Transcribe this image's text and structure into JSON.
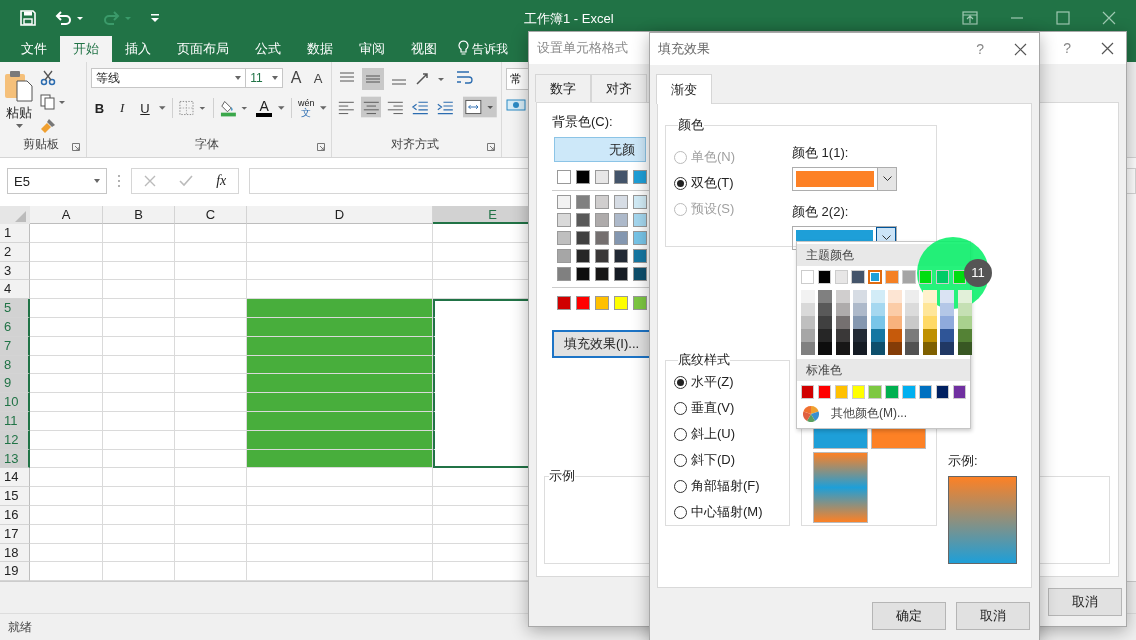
{
  "window": {
    "title": "工作簿1 - Excel"
  },
  "ribbon_tabs": [
    {
      "label": "文件",
      "kind": "tab",
      "selected": false
    },
    {
      "label": "开始",
      "kind": "tab",
      "selected": true
    },
    {
      "label": "插入",
      "kind": "tab",
      "selected": false
    },
    {
      "label": "页面布局",
      "kind": "tab",
      "selected": false
    },
    {
      "label": "公式",
      "kind": "tab",
      "selected": false
    },
    {
      "label": "数据",
      "kind": "tab",
      "selected": false
    },
    {
      "label": "审阅",
      "kind": "tab",
      "selected": false
    },
    {
      "label": "视图",
      "kind": "tab",
      "selected": false
    },
    {
      "label": "告诉我",
      "kind": "search",
      "selected": false
    }
  ],
  "clipboard": {
    "paste_label": "粘贴",
    "group_label": "剪贴板"
  },
  "font": {
    "name": "等线",
    "size": "11",
    "size_buttons": [
      "A",
      "A"
    ],
    "format_buttons": [
      "B",
      "I",
      "U"
    ],
    "color_letter": "A",
    "phonetic": "wén",
    "phonetic_char": "文",
    "group_label": "字体"
  },
  "alignment": {
    "group_label": "对齐方式"
  },
  "number": {
    "format": "常"
  },
  "name_box": "E5",
  "fx_label": "fx",
  "sheet": {
    "columns": [
      {
        "label": "A",
        "selected": false
      },
      {
        "label": "B",
        "selected": false
      },
      {
        "label": "C",
        "selected": false
      },
      {
        "label": "D",
        "selected": false,
        "color": "#48ae3c"
      },
      {
        "label": "E",
        "selected": true
      }
    ],
    "rows": [
      {
        "label": "1",
        "selected": false,
        "filled": false
      },
      {
        "label": "2",
        "selected": false,
        "filled": false
      },
      {
        "label": "3",
        "selected": false,
        "filled": false
      },
      {
        "label": "4",
        "selected": false,
        "filled": false
      },
      {
        "label": "5",
        "selected": true,
        "filled": true
      },
      {
        "label": "6",
        "selected": true,
        "filled": true
      },
      {
        "label": "7",
        "selected": true,
        "filled": true
      },
      {
        "label": "8",
        "selected": true,
        "filled": true
      },
      {
        "label": "9",
        "selected": true,
        "filled": true
      },
      {
        "label": "10",
        "selected": true,
        "filled": true
      },
      {
        "label": "11",
        "selected": true,
        "filled": true
      },
      {
        "label": "12",
        "selected": true,
        "filled": true
      },
      {
        "label": "13",
        "selected": true,
        "filled": true
      },
      {
        "label": "14",
        "selected": false,
        "filled": false
      },
      {
        "label": "15",
        "selected": false,
        "filled": false
      },
      {
        "label": "16",
        "selected": false,
        "filled": false
      },
      {
        "label": "17",
        "selected": false,
        "filled": false
      },
      {
        "label": "18",
        "selected": false,
        "filled": false
      },
      {
        "label": "19",
        "selected": false,
        "filled": false
      }
    ]
  },
  "status_bar": {
    "text": "就绪"
  },
  "format_dialog": {
    "title": "设置单元格格式",
    "help": "?",
    "tabs": [
      {
        "label": "数字"
      },
      {
        "label": "对齐"
      }
    ],
    "background_label": "背景色(C):",
    "no_color": "无颜",
    "theme_colors": [
      {
        "color": "#ffffff"
      },
      {
        "color": "#000000"
      },
      {
        "color": "#e7e6e6"
      },
      {
        "color": "#44546a"
      },
      {
        "color": "#1e9fd8"
      }
    ],
    "shade_rows": [
      [
        {
          "color": "#f2f2f2"
        },
        {
          "color": "#808080"
        },
        {
          "color": "#d0cece"
        },
        {
          "color": "#d6dce4"
        },
        {
          "color": "#d2ecf7"
        }
      ],
      [
        {
          "color": "#d9d9d9"
        },
        {
          "color": "#595959"
        },
        {
          "color": "#aeabab"
        },
        {
          "color": "#adb9ca"
        },
        {
          "color": "#a5d8f0"
        }
      ],
      [
        {
          "color": "#bfbfbf"
        },
        {
          "color": "#404040"
        },
        {
          "color": "#757070"
        },
        {
          "color": "#8497b0"
        },
        {
          "color": "#78c5e8"
        }
      ],
      [
        {
          "color": "#a6a6a6"
        },
        {
          "color": "#262626"
        },
        {
          "color": "#3a3838"
        },
        {
          "color": "#222a35"
        },
        {
          "color": "#1577a2"
        }
      ],
      [
        {
          "color": "#808080"
        },
        {
          "color": "#0d0d0d"
        },
        {
          "color": "#171616"
        },
        {
          "color": "#161c24"
        },
        {
          "color": "#0e4f6c"
        }
      ]
    ],
    "standard_colors": [
      {
        "color": "#d00000"
      },
      {
        "color": "#ff0000"
      },
      {
        "color": "#ffc000"
      },
      {
        "color": "#ffff00"
      },
      {
        "color": "#7dc842"
      }
    ],
    "fill_effects_button": "填充效果(I)...",
    "sample_label": "示例",
    "cancel": "取消"
  },
  "fill_dialog": {
    "title": "填充效果",
    "help": "?",
    "tabs": [
      {
        "label": "渐变",
        "selected": true
      }
    ],
    "colors_group": {
      "label": "颜色",
      "options": [
        {
          "label": "单色(N)",
          "selected": false,
          "disabled": true
        },
        {
          "label": "双色(T)",
          "selected": true,
          "disabled": false
        },
        {
          "label": "预设(S)",
          "selected": false,
          "disabled": true
        }
      ],
      "color1": {
        "label": "颜色 1(1):",
        "color": "#fd8125",
        "expanded": false
      },
      "color2": {
        "label": "颜色 2(2):",
        "color": "#1e9fd8",
        "expanded": true
      }
    },
    "shading": {
      "label": "底纹样式",
      "options": [
        {
          "label": "水平(Z)",
          "selected": true
        },
        {
          "label": "垂直(V)",
          "selected": false
        },
        {
          "label": "斜上(U)",
          "selected": false
        },
        {
          "label": "斜下(D)",
          "selected": false
        },
        {
          "label": "角部辐射(F)",
          "selected": false
        },
        {
          "label": "中心辐射(M)",
          "selected": false
        }
      ]
    },
    "variants": [
      {
        "kind": "down",
        "selected": false
      },
      {
        "kind": "up",
        "selected": false
      },
      {
        "kind": "mirror",
        "selected": false
      }
    ],
    "sample_label": "示例:",
    "buttons": [
      "确定",
      "取消"
    ]
  },
  "color_menu": {
    "theme_label": "主题颜色",
    "theme_colors": [
      {
        "color": "#ffffff",
        "selected": false,
        "shades": [
          {
            "color": "#f2f2f2"
          },
          {
            "color": "#d9d9d9"
          },
          {
            "color": "#bfbfbf"
          },
          {
            "color": "#a6a6a6"
          },
          {
            "color": "#808080"
          }
        ]
      },
      {
        "color": "#000000",
        "selected": false,
        "shades": [
          {
            "color": "#808080"
          },
          {
            "color": "#595959"
          },
          {
            "color": "#404040"
          },
          {
            "color": "#262626"
          },
          {
            "color": "#0d0d0d"
          }
        ]
      },
      {
        "color": "#e7e6e6",
        "selected": false,
        "shades": [
          {
            "color": "#d0cece"
          },
          {
            "color": "#aeabab"
          },
          {
            "color": "#757070"
          },
          {
            "color": "#3a3838"
          },
          {
            "color": "#171616"
          }
        ]
      },
      {
        "color": "#44546a",
        "selected": false,
        "shades": [
          {
            "color": "#d6dce4"
          },
          {
            "color": "#adb9ca"
          },
          {
            "color": "#8497b0"
          },
          {
            "color": "#222a35"
          },
          {
            "color": "#161c24"
          }
        ]
      },
      {
        "color": "#1e9fd8",
        "selected": true,
        "shades": [
          {
            "color": "#d2ecf7"
          },
          {
            "color": "#a5d8f0"
          },
          {
            "color": "#78c5e8"
          },
          {
            "color": "#1577a2"
          },
          {
            "color": "#0e4f6c"
          }
        ]
      },
      {
        "color": "#f48024",
        "selected": false,
        "shades": [
          {
            "color": "#fde5d3"
          },
          {
            "color": "#fbcca7"
          },
          {
            "color": "#f8b27c"
          },
          {
            "color": "#c65a0b"
          },
          {
            "color": "#843c07"
          }
        ]
      },
      {
        "color": "#a5a5a5",
        "selected": false,
        "shades": [
          {
            "color": "#ededed"
          },
          {
            "color": "#dbdbdb"
          },
          {
            "color": "#c9c9c9"
          },
          {
            "color": "#7b7b7b"
          },
          {
            "color": "#525252"
          }
        ]
      },
      {
        "color": "#00dd10",
        "selected": false,
        "shades": [
          {
            "color": "#fff2cc"
          },
          {
            "color": "#ffe699"
          },
          {
            "color": "#ffd966"
          },
          {
            "color": "#bf9000"
          },
          {
            "color": "#7f6000"
          }
        ]
      },
      {
        "color": "#00cc66",
        "selected": false,
        "shades": [
          {
            "color": "#dae3f3"
          },
          {
            "color": "#b4c7e7"
          },
          {
            "color": "#8faadc"
          },
          {
            "color": "#2f5597"
          },
          {
            "color": "#203864"
          }
        ]
      },
      {
        "color": "#00dd10",
        "selected": false,
        "shades": [
          {
            "color": "#e2f0d9"
          },
          {
            "color": "#c5e0b4"
          },
          {
            "color": "#a9d18e"
          },
          {
            "color": "#548235"
          },
          {
            "color": "#385723"
          }
        ]
      }
    ],
    "standard_label": "标准色",
    "standard_colors": [
      {
        "color": "#d00000"
      },
      {
        "color": "#ff0000"
      },
      {
        "color": "#ffc000"
      },
      {
        "color": "#ffff00"
      },
      {
        "color": "#7dc842"
      },
      {
        "color": "#00b050"
      },
      {
        "color": "#00b0f0"
      },
      {
        "color": "#0070c0"
      },
      {
        "color": "#002060"
      },
      {
        "color": "#7030a0"
      }
    ],
    "more_colors": "其他颜色(M)..."
  },
  "click_marker": {
    "label": "11"
  }
}
